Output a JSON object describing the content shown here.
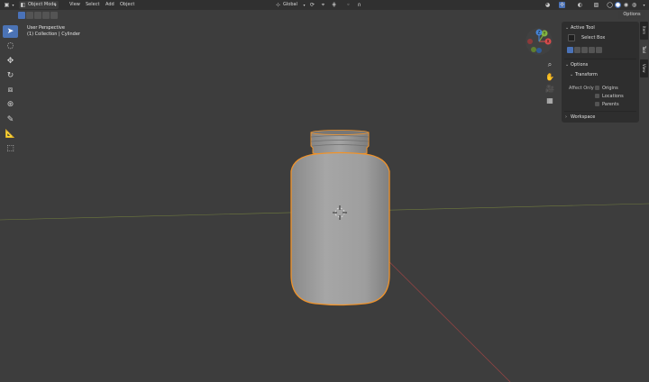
{
  "header": {
    "mode_label": "Object Mode",
    "menu": [
      "View",
      "Select",
      "Add",
      "Object"
    ],
    "orientation": "Global"
  },
  "options_label": "Options",
  "viewport": {
    "perspective_label": "User Perspective",
    "collection_label": "(1) Collection | Cylinder"
  },
  "gizmo": {
    "x": "X",
    "y": "Y",
    "z": "Z"
  },
  "panel": {
    "tabs": [
      "Item",
      "Tool",
      "View"
    ],
    "active_tool_title": "Active Tool",
    "active_tool_name": "Select Box",
    "options_title": "Options",
    "transform_title": "Transform",
    "affect_only": "Affect Only",
    "checks": [
      "Origins",
      "Locations",
      "Parents"
    ],
    "workspace_title": "Workspace"
  },
  "icons": {
    "editor_type": "cube-icon",
    "tools": [
      "cursor-icon",
      "select-circle-icon",
      "move-icon",
      "rotate-icon",
      "scale-icon",
      "transform-icon",
      "annotate-icon",
      "measure-icon",
      "add-cube-icon"
    ]
  },
  "colors": {
    "accent": "#4a72b8",
    "selection_outline": "#f0932a",
    "axis_x": "#b04848",
    "axis_y": "#7c9a3a",
    "viewport_bg": "#3d3d3d"
  }
}
